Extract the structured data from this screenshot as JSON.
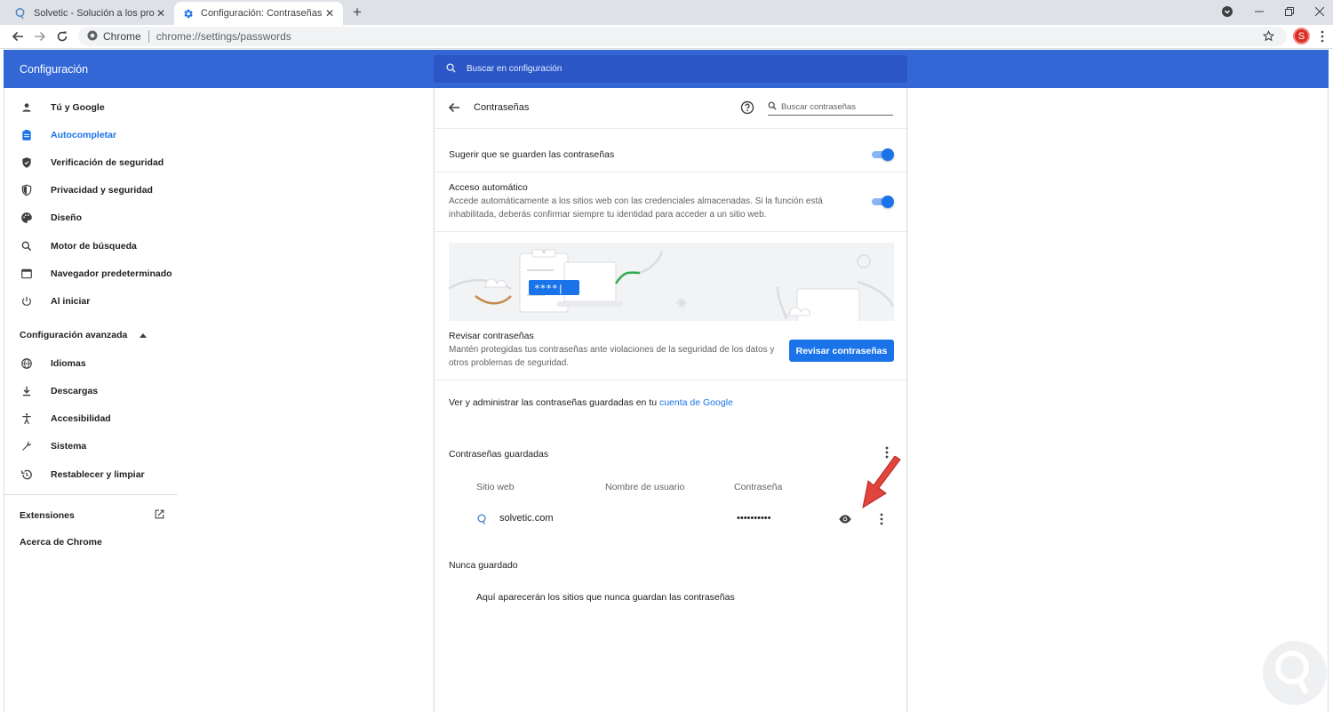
{
  "browser": {
    "tabs": [
      {
        "title": "Solvetic - Solución a los problem",
        "active": false
      },
      {
        "title": "Configuración: Contraseñas",
        "active": true
      }
    ],
    "omnibox": {
      "site_chip": "Chrome",
      "url": "chrome://settings/passwords"
    },
    "profile_initial": "S"
  },
  "header": {
    "title": "Configuración",
    "search_placeholder": "Buscar en configuración"
  },
  "sidebar": {
    "items": [
      {
        "label": "Tú y Google",
        "icon": "person-icon"
      },
      {
        "label": "Autocompletar",
        "icon": "clipboard-icon",
        "active": true
      },
      {
        "label": "Verificación de seguridad",
        "icon": "shield-check-icon"
      },
      {
        "label": "Privacidad y seguridad",
        "icon": "shield-icon"
      },
      {
        "label": "Diseño",
        "icon": "palette-icon"
      },
      {
        "label": "Motor de búsqueda",
        "icon": "search-icon"
      },
      {
        "label": "Navegador predeterminado",
        "icon": "browser-icon"
      },
      {
        "label": "Al iniciar",
        "icon": "power-icon"
      }
    ],
    "advanced_label": "Configuración avanzada",
    "advanced_items": [
      {
        "label": "Idiomas",
        "icon": "globe-icon"
      },
      {
        "label": "Descargas",
        "icon": "download-icon"
      },
      {
        "label": "Accesibilidad",
        "icon": "accessibility-icon"
      },
      {
        "label": "Sistema",
        "icon": "wrench-icon"
      },
      {
        "label": "Restablecer y limpiar",
        "icon": "history-icon"
      }
    ],
    "extensions_label": "Extensiones",
    "about_label": "Acerca de Chrome"
  },
  "passwords": {
    "title": "Contraseñas",
    "search_placeholder": "Buscar contraseñas",
    "offer_to_save": {
      "label": "Sugerir que se guarden las contraseñas",
      "enabled": true
    },
    "auto_signin": {
      "label": "Acceso automático",
      "description_line1": "Accede automáticamente a los sitios web con las credenciales almacenadas. Si la función está",
      "description_line2": "inhabilitada, deberás confirmar siempre tu identidad para acceder a un sitio web.",
      "enabled": true
    },
    "banner_mask": "****|",
    "check": {
      "label": "Revisar contraseñas",
      "description_line1": "Mantén protegidas tus contraseñas ante violaciones de la seguridad de los datos y",
      "description_line2": "otros problemas de seguridad.",
      "button": "Revisar contraseñas"
    },
    "account_text": "Ver y administrar las contraseñas guardadas en tu",
    "account_link": "cuenta de Google",
    "saved_title": "Contraseñas guardadas",
    "columns": [
      "Sitio web",
      "Nombre de usuario",
      "Contraseña"
    ],
    "saved": [
      {
        "site": "solvetic.com",
        "username": "",
        "password": "••••••••••"
      }
    ],
    "never_title": "Nunca guardado",
    "never_empty": "Aquí aparecerán los sitios que nunca guardan las contraseñas"
  },
  "colors": {
    "header_blue": "#3367d6",
    "accent": "#1a73e8",
    "arrow_red": "#e0443c"
  }
}
